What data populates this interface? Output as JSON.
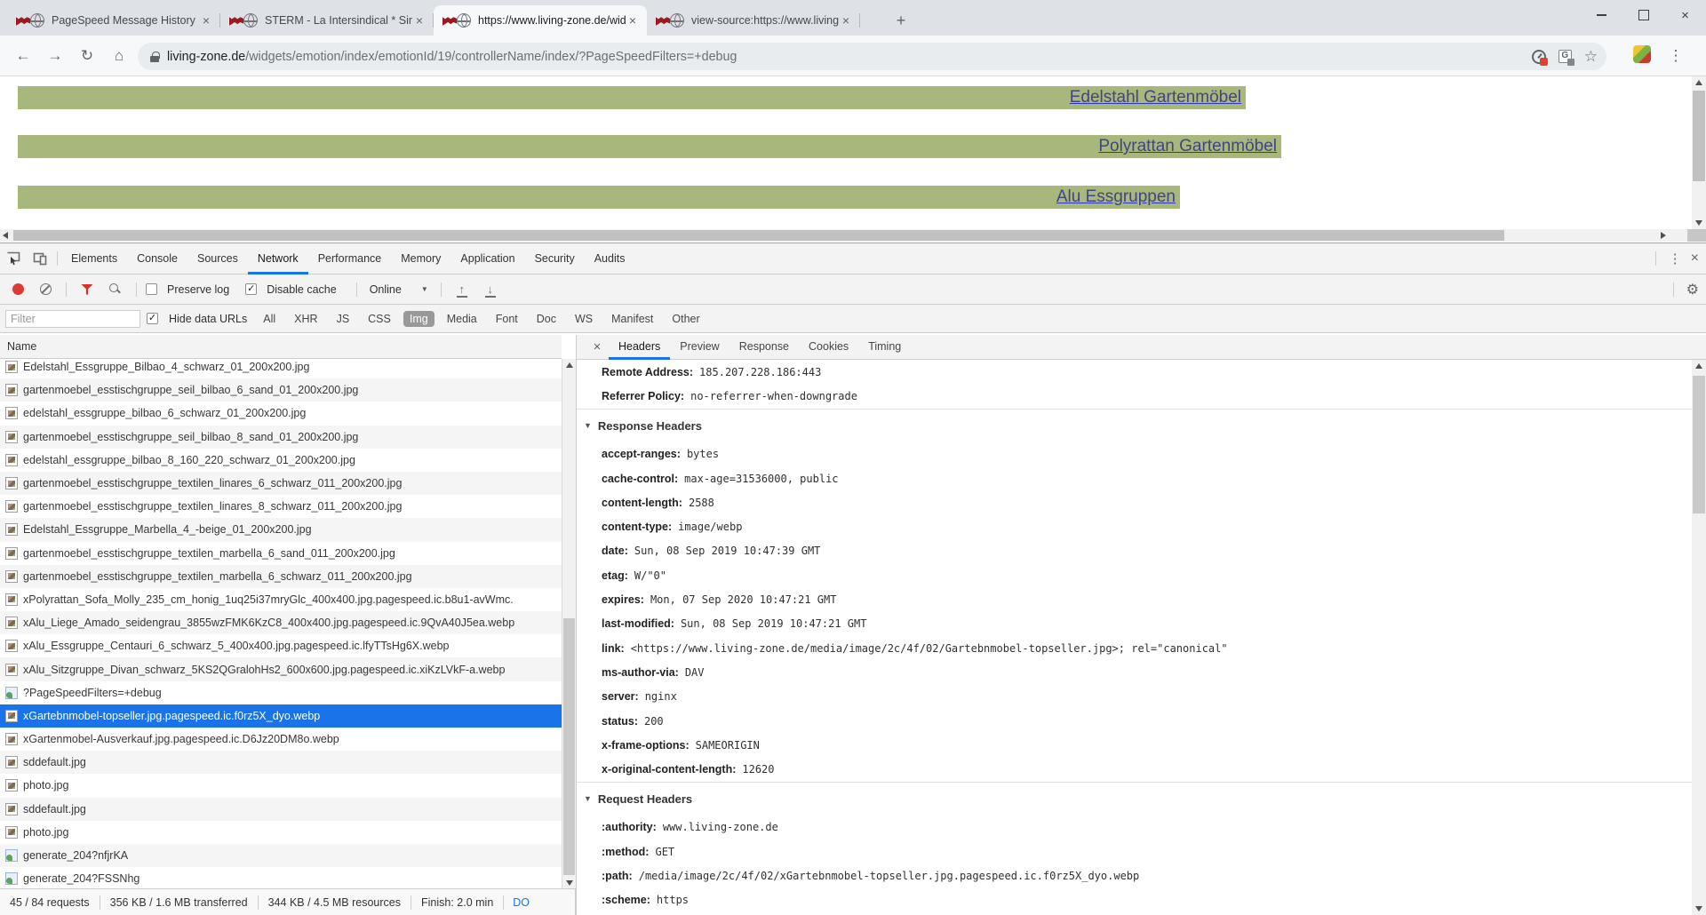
{
  "browser": {
    "tabs": [
      {
        "title": "PageSpeed Message History",
        "kind": "flag"
      },
      {
        "title": "STERM - La Intersindical * Sindica",
        "kind": "flag"
      },
      {
        "title": "https://www.living-zone.de/widge",
        "kind": "globe",
        "state": "active"
      },
      {
        "title": "view-source:https://www.living-z",
        "kind": "globe"
      }
    ],
    "tab_close_glyph": "×",
    "newtab_glyph": "+",
    "window": {
      "close_glyph": "×"
    },
    "nav": {
      "back": "←",
      "forward": "→",
      "reload": "↻",
      "home": "⌂"
    },
    "url": {
      "domain": "living-zone.de",
      "path": "/widgets/emotion/index/emotionId/19/controllerName/index/?PageSpeedFilters=+debug"
    },
    "omni": {
      "translate_letter": "G",
      "star": "☆",
      "menu": "⋮"
    }
  },
  "page": {
    "bar_color": "#a8b87c",
    "banners": [
      {
        "label": "Edelstahl Gartenmöbel",
        "style": "top:11px;width:1382px"
      },
      {
        "label": "Polyrattan Gartenmöbel",
        "style": "top:66px;width:1422px"
      },
      {
        "label": "Alu Essgruppen",
        "style": "top:123px;width:1308px"
      }
    ]
  },
  "devtools": {
    "panel_tabs": [
      {
        "label": "Elements"
      },
      {
        "label": "Console"
      },
      {
        "label": "Sources"
      },
      {
        "label": "Network",
        "state": "active"
      },
      {
        "label": "Performance"
      },
      {
        "label": "Memory"
      },
      {
        "label": "Application"
      },
      {
        "label": "Security"
      },
      {
        "label": "Audits"
      }
    ],
    "icons": {
      "menu_dots": "⋮",
      "close": "×",
      "gear": "⚙",
      "caret": "▼",
      "check": "✓",
      "import_arrow": "↑",
      "export_arrow": "↓",
      "section_tri": "▼"
    },
    "toolbar": {
      "preserve_log": "Preserve log",
      "disable_cache": "Disable cache",
      "online": "Online"
    },
    "filterbar": {
      "placeholder": "Filter",
      "hide_data_urls": "Hide data URLs",
      "chips": [
        {
          "label": "All"
        },
        {
          "label": "XHR"
        },
        {
          "label": "JS"
        },
        {
          "label": "CSS"
        },
        {
          "label": "Img",
          "state": "active"
        },
        {
          "label": "Media"
        },
        {
          "label": "Font"
        },
        {
          "label": "Doc"
        },
        {
          "label": "WS"
        },
        {
          "label": "Manifest"
        },
        {
          "label": "Other"
        }
      ]
    },
    "network": {
      "name_header": "Name",
      "rows": [
        {
          "name": "Edelstahl_Essgruppe_Bilbao_4_schwarz_01_200x200.jpg",
          "kind": "img"
        },
        {
          "name": "gartenmoebel_esstischgruppe_seil_bilbao_6_sand_01_200x200.jpg",
          "kind": "img"
        },
        {
          "name": "edelstahl_essgruppe_bilbao_6_schwarz_01_200x200.jpg",
          "kind": "img"
        },
        {
          "name": "gartenmoebel_esstischgruppe_seil_bilbao_8_sand_01_200x200.jpg",
          "kind": "img"
        },
        {
          "name": "edelstahl_essgruppe_bilbao_8_160_220_schwarz_01_200x200.jpg",
          "kind": "img"
        },
        {
          "name": "gartenmoebel_esstischgruppe_textilen_linares_6_schwarz_011_200x200.jpg",
          "kind": "img"
        },
        {
          "name": "gartenmoebel_esstischgruppe_textilen_linares_8_schwarz_011_200x200.jpg",
          "kind": "img"
        },
        {
          "name": "Edelstahl_Essgruppe_Marbella_4_-beige_01_200x200.jpg",
          "kind": "img"
        },
        {
          "name": "gartenmoebel_esstischgruppe_textilen_marbella_6_sand_011_200x200.jpg",
          "kind": "img"
        },
        {
          "name": "gartenmoebel_esstischgruppe_textilen_marbella_6_schwarz_011_200x200.jpg",
          "kind": "img"
        },
        {
          "name": "xPolyrattan_Sofa_Molly_235_cm_honig_1uq25i37mryGlc_400x400.jpg.pagespeed.ic.b8u1-avWmc.",
          "kind": "img"
        },
        {
          "name": "xAlu_Liege_Amado_seidengrau_3855wzFMK6KzC8_400x400.jpg.pagespeed.ic.9QvA40J5ea.webp",
          "kind": "img"
        },
        {
          "name": "xAlu_Essgruppe_Centauri_6_schwarz_5_400x400.jpg.pagespeed.ic.lfyTTsHg6X.webp",
          "kind": "img"
        },
        {
          "name": "xAlu_Sitzgruppe_Divan_schwarz_5KS2QGralohHs2_600x600.jpg.pagespeed.ic.xiKzLVkF-a.webp",
          "kind": "img"
        },
        {
          "name": "?PageSpeedFilters=+debug",
          "kind": "doc"
        },
        {
          "name": "xGartebnmobel-topseller.jpg.pagespeed.ic.f0rz5X_dyo.webp",
          "kind": "img",
          "state": "selected"
        },
        {
          "name": "xGartenmobel-Ausverkauf.jpg.pagespeed.ic.D6Jz20DM8o.webp",
          "kind": "img"
        },
        {
          "name": "sddefault.jpg",
          "kind": "img"
        },
        {
          "name": "photo.jpg",
          "kind": "img"
        },
        {
          "name": "sddefault.jpg",
          "kind": "img"
        },
        {
          "name": "photo.jpg",
          "kind": "img"
        },
        {
          "name": "generate_204?nfjrKA",
          "kind": "doc"
        },
        {
          "name": "generate_204?FSSNhg",
          "kind": "doc"
        }
      ]
    },
    "detail": {
      "tabs": [
        {
          "label": "Headers",
          "state": "active"
        },
        {
          "label": "Preview"
        },
        {
          "label": "Response"
        },
        {
          "label": "Cookies"
        },
        {
          "label": "Timing"
        }
      ],
      "general": [
        {
          "n": "Remote Address:",
          "v": "185.207.228.186:443"
        },
        {
          "n": "Referrer Policy:",
          "v": "no-referrer-when-downgrade"
        }
      ],
      "response_title": "Response Headers",
      "response_headers": [
        {
          "n": "accept-ranges:",
          "v": "bytes"
        },
        {
          "n": "cache-control:",
          "v": "max-age=31536000, public"
        },
        {
          "n": "content-length:",
          "v": "2588"
        },
        {
          "n": "content-type:",
          "v": "image/webp"
        },
        {
          "n": "date:",
          "v": "Sun, 08 Sep 2019 10:47:39 GMT"
        },
        {
          "n": "etag:",
          "v": "W/\"0\""
        },
        {
          "n": "expires:",
          "v": "Mon, 07 Sep 2020 10:47:21 GMT"
        },
        {
          "n": "last-modified:",
          "v": "Sun, 08 Sep 2019 10:47:21 GMT"
        },
        {
          "n": "link:",
          "v": "<https://www.living-zone.de/media/image/2c/4f/02/Gartebnmobel-topseller.jpg>; rel=\"canonical\""
        },
        {
          "n": "ms-author-via:",
          "v": "DAV"
        },
        {
          "n": "server:",
          "v": "nginx"
        },
        {
          "n": "status:",
          "v": "200"
        },
        {
          "n": "x-frame-options:",
          "v": "SAMEORIGIN"
        },
        {
          "n": "x-original-content-length:",
          "v": "12620"
        }
      ],
      "request_title": "Request Headers",
      "request_headers": [
        {
          "n": ":authority:",
          "v": "www.living-zone.de"
        },
        {
          "n": ":method:",
          "v": "GET"
        },
        {
          "n": ":path:",
          "v": "/media/image/2c/4f/02/xGartebnmobel-topseller.jpg.pagespeed.ic.f0rz5X_dyo.webp"
        },
        {
          "n": ":scheme:",
          "v": "https"
        }
      ]
    },
    "footer": {
      "requests": "45 / 84 requests",
      "transferred": "356 KB / 1.6 MB transferred",
      "resources": "344 KB / 4.5 MB resources",
      "finish": "Finish: 2.0 min",
      "dom": "DO"
    }
  }
}
